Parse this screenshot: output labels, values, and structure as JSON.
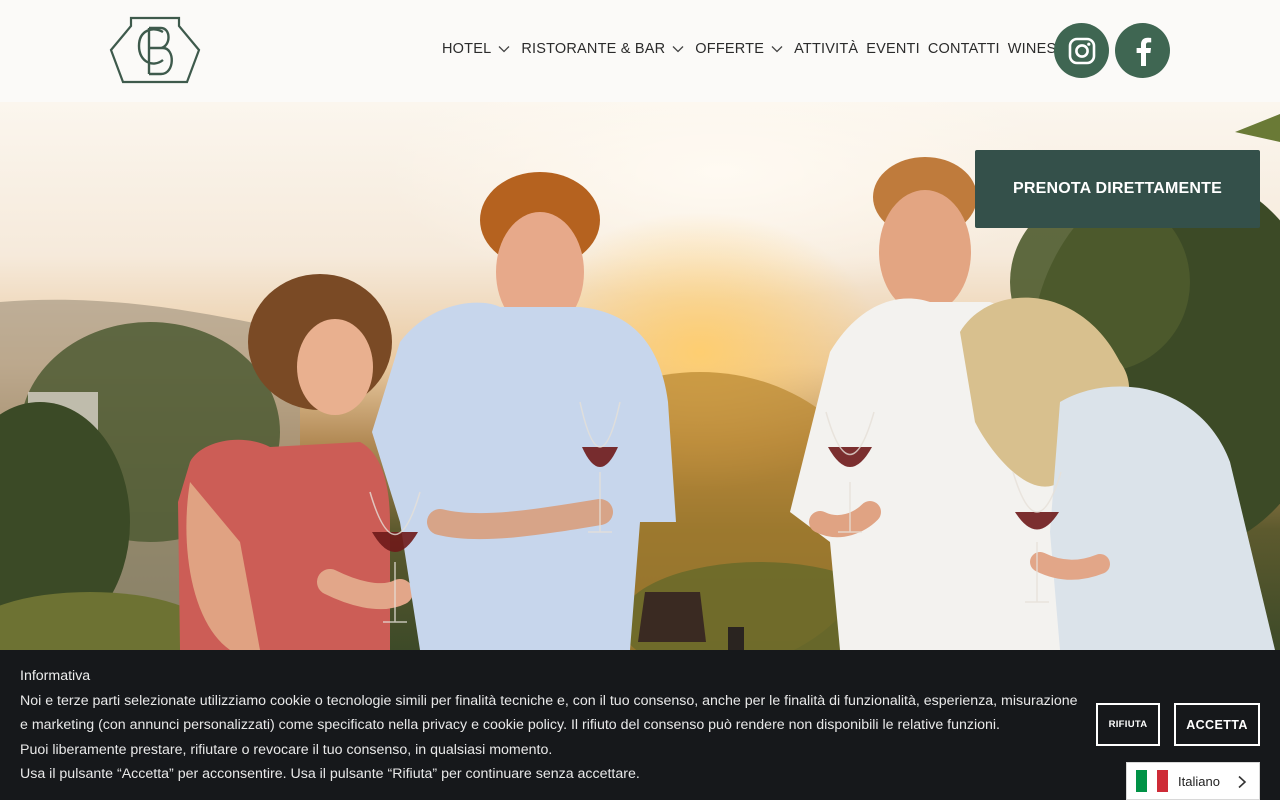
{
  "nav": {
    "items": [
      {
        "label": "HOTEL",
        "dropdown": true
      },
      {
        "label": "RISTORANTE & BAR",
        "dropdown": true
      },
      {
        "label": "OFFERTE",
        "dropdown": true
      },
      {
        "label": "ATTIVITÀ",
        "dropdown": false
      },
      {
        "label": "EVENTI",
        "dropdown": false
      },
      {
        "label": "CONTATTI",
        "dropdown": false
      },
      {
        "label": "WINESHOP",
        "dropdown": false
      }
    ]
  },
  "social": {
    "icons": [
      "instagram-icon",
      "facebook-icon"
    ],
    "color": "#3f6652"
  },
  "hero": {
    "cta_label": "PRENOTA DIRETTAMENTE",
    "cta_color": "#34504a"
  },
  "cookie": {
    "title": "Informativa",
    "line1": "Noi e terze parti selezionate utilizziamo cookie o tecnologie simili per finalità tecniche e, con il tuo consenso, anche per le finalità di funzionalità, esperienza, misurazione e marketing (con annunci personalizzati) come specificato nella privacy e cookie policy. Il rifiuto del consenso può rendere non disponibili le relative funzioni.",
    "line2": "Puoi liberamente prestare, rifiutare o revocare il tuo consenso, in qualsiasi momento.",
    "line3": "Usa il pulsante “Accetta” per acconsentire. Usa il pulsante “Rifiuta” per continuare senza accettare.",
    "reject_label": "RIFIUTA",
    "accept_label": "ACCETTA"
  },
  "language": {
    "label": "Italiano",
    "flag_colors": [
      "#009246",
      "#ffffff",
      "#ce2b37"
    ]
  }
}
